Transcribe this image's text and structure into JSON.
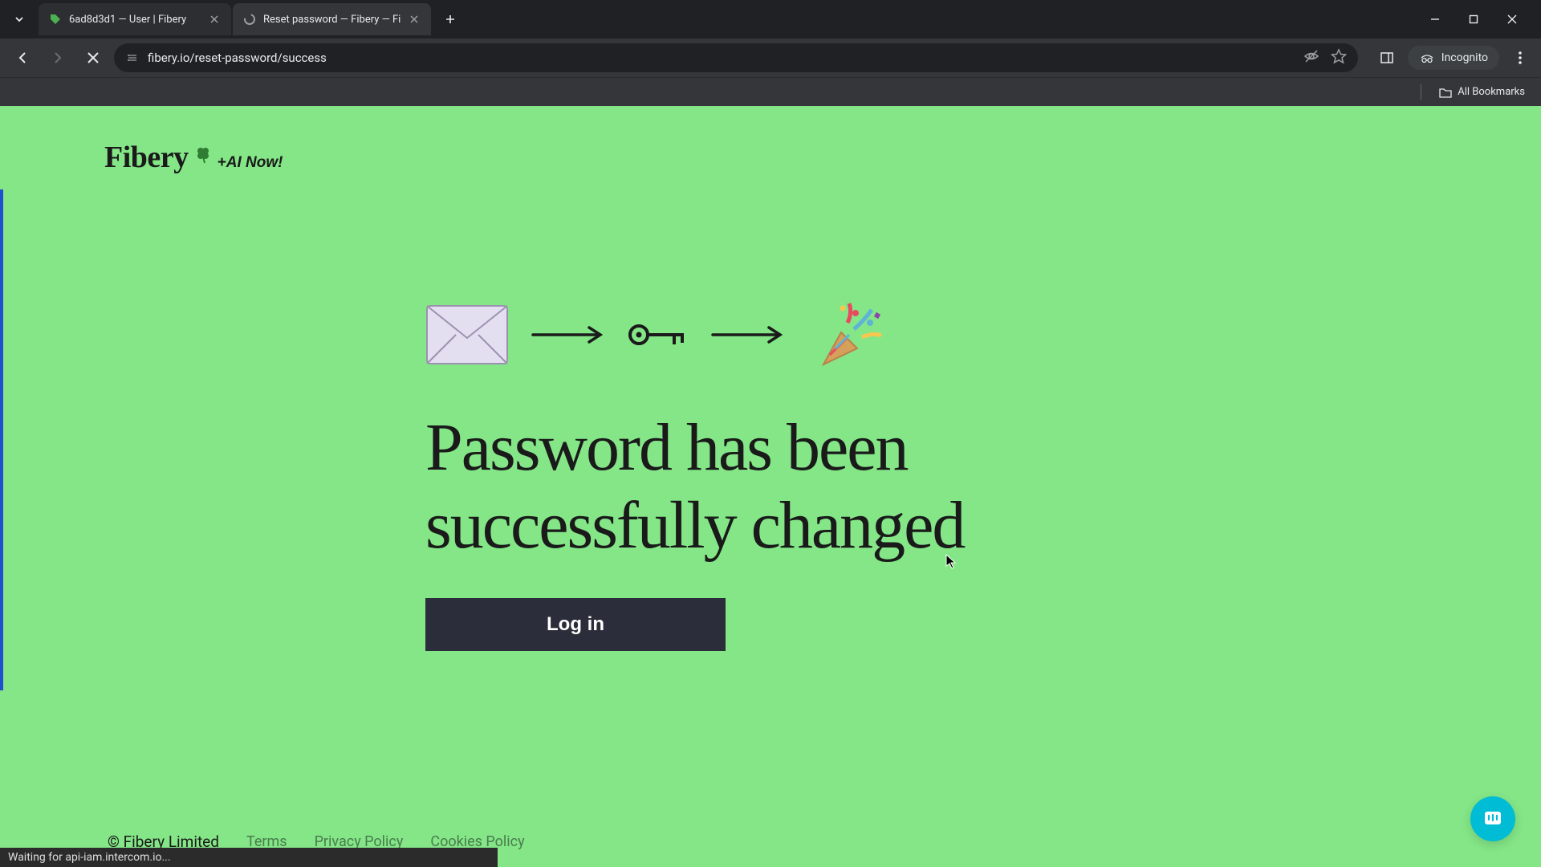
{
  "browser": {
    "tabs": [
      {
        "title": "6ad8d3d1 — User | Fibery",
        "active": false
      },
      {
        "title": "Reset password — Fibery — Fi",
        "active": true
      }
    ],
    "url": "fibery.io/reset-password/success",
    "incognito_label": "Incognito",
    "bookmarks_label": "All Bookmarks",
    "status_text": "Waiting for api-iam.intercom.io..."
  },
  "logo": {
    "text": "Fibery",
    "tagline": "+AI Now!"
  },
  "main": {
    "heading": "Password has been successfully changed",
    "login_label": "Log in"
  },
  "footer": {
    "copyright": "© Fibery Limited",
    "links": [
      "Terms",
      "Privacy Policy",
      "Cookies Policy"
    ]
  }
}
